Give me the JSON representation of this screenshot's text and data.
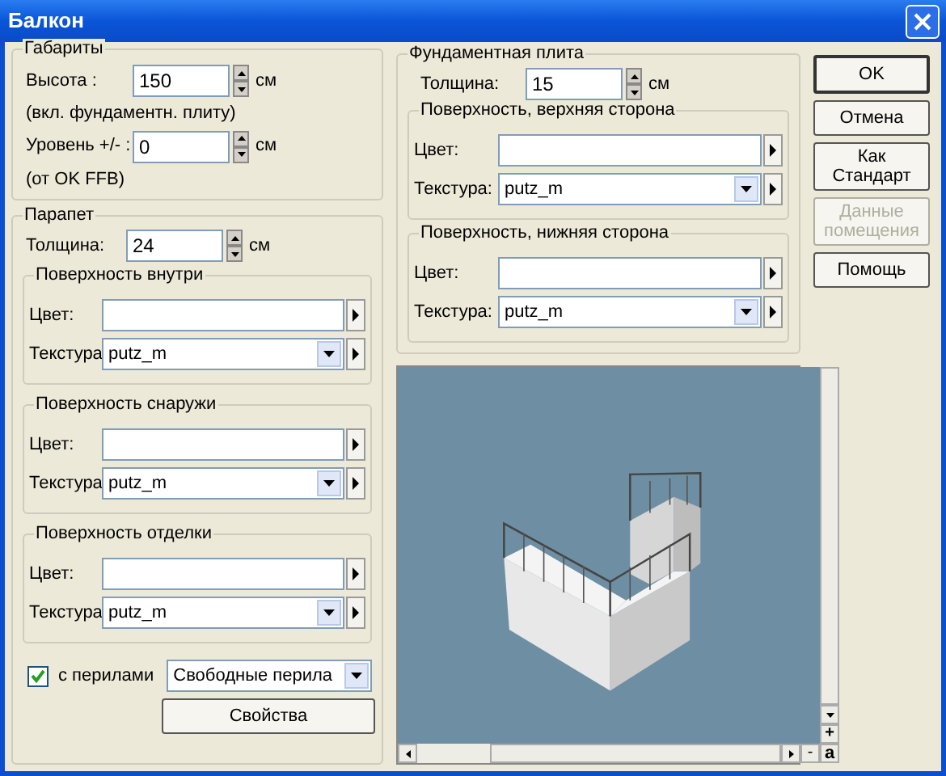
{
  "window": {
    "title": "Балкон"
  },
  "dimensions": {
    "legend": "Габариты",
    "fields": [
      {
        "label": "Высота :",
        "value": "150",
        "unit": "см",
        "note": "(вкл. фундаментн. плиту)"
      },
      {
        "label": "Уровень +/- :",
        "value": "0",
        "unit": "см",
        "note": "(от OK FFB)"
      }
    ]
  },
  "parapet": {
    "legend": "Парапет",
    "thickness": {
      "label": "Толщина:",
      "value": "24",
      "unit": "см"
    },
    "surfaces": [
      {
        "legend": "Поверхность внутри",
        "color_label": "Цвет:",
        "texture_label": "Текстура",
        "texture": "putz_m"
      },
      {
        "legend": "Поверхность снаружи",
        "color_label": "Цвет:",
        "texture_label": "Текстура",
        "texture": "putz_m"
      },
      {
        "legend": "Поверхность отделки",
        "color_label": "Цвет:",
        "texture_label": "Текстура",
        "texture": "putz_m"
      }
    ],
    "railing": {
      "checked": true,
      "label": "с перилами",
      "type": "Свободные перила",
      "button": "Свойства"
    }
  },
  "slab": {
    "legend": "Фундаментная плита",
    "thickness": {
      "label": "Толщина:",
      "value": "15",
      "unit": "см"
    },
    "surfaces": [
      {
        "legend": "Поверхность, верхняя сторона",
        "color_label": "Цвет:",
        "texture_label": "Текстура:",
        "texture": "putz_m"
      },
      {
        "legend": "Поверхность, нижняя сторона",
        "color_label": "Цвет:",
        "texture_label": "Текстура:",
        "texture": "putz_m"
      }
    ]
  },
  "buttons": [
    {
      "label": "OK",
      "default": true,
      "disabled": false
    },
    {
      "label": "Отмена",
      "default": false,
      "disabled": false
    },
    {
      "label": "Как Стандарт",
      "default": false,
      "disabled": false
    },
    {
      "label": "Данные помещения",
      "default": false,
      "disabled": true
    },
    {
      "label": "Помощь",
      "default": false,
      "disabled": false
    }
  ],
  "preview": {
    "zoom_in": "+",
    "zoom_out": "-",
    "auto": "a"
  }
}
